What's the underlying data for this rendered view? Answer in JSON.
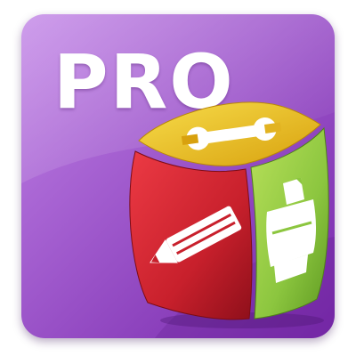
{
  "icon": {
    "badge_text": "PRO",
    "colors": {
      "tile_light": "#c183e6",
      "tile_dark": "#7a2aad",
      "edit_face": "#c8202c",
      "tools_face": "#e6b817",
      "print_face": "#8cc63f",
      "glyph": "#ffffff"
    },
    "faces": [
      {
        "name": "edit",
        "icon": "pencil-icon"
      },
      {
        "name": "tools",
        "icon": "wrench-icon"
      },
      {
        "name": "print",
        "icon": "printer-icon"
      }
    ]
  }
}
